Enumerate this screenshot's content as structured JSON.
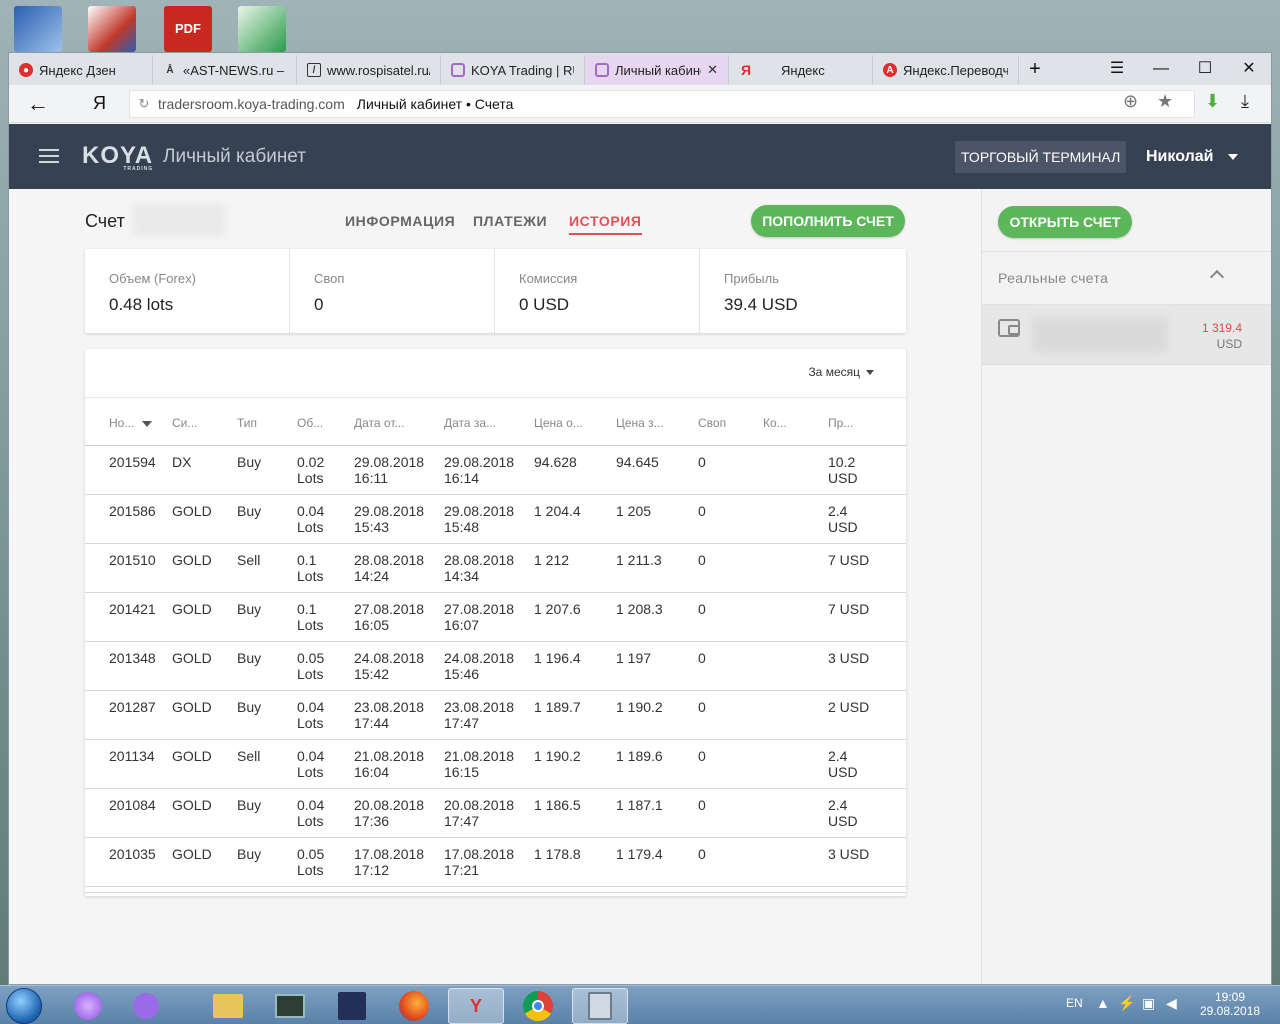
{
  "desktop": {
    "icons": [
      "word-doc-icon",
      "app-icon",
      "pdf-icon",
      "shortcut-icon"
    ],
    "pdf_label": "PDF"
  },
  "browser": {
    "tabs": [
      {
        "label": "Яндекс Дзен",
        "icon": "zen-icon",
        "color": "#e02d2d"
      },
      {
        "label": "«AST-NEWS.ru – А",
        "icon": "ast-icon",
        "color": "#333333"
      },
      {
        "label": "www.rospisatel.ru/",
        "icon": "site-icon",
        "color": "#333333"
      },
      {
        "label": "KOYA Trading | RU",
        "icon": "koya-icon",
        "color": "#a36bc2"
      },
      {
        "label": "Личный кабине",
        "icon": "koya-icon",
        "color": "#a36bc2"
      },
      {
        "label": "Яндекс",
        "icon": "yandex-icon",
        "color": "#e02d2d"
      },
      {
        "label": "Яндекс.Переводч",
        "icon": "translate-icon",
        "color": "#e02d2d"
      }
    ],
    "new_tab": "+",
    "address": {
      "back": "←",
      "ya": "Я",
      "domain": "tradersroom.koya-trading.com",
      "title": "Личный кабинет • Счета"
    }
  },
  "header": {
    "logo": "KOYA",
    "logo_sub": "TRADING",
    "title": "Личный кабинет",
    "terminal_button": "ТОРГОВЫЙ ТЕРМИНАЛ",
    "user": "Николай"
  },
  "account": {
    "label": "Счет",
    "tabs": [
      "ИНФОРМАЦИЯ",
      "ПЛАТЕЖИ",
      "ИСТОРИЯ"
    ],
    "active_tab": "ИСТОРИЯ",
    "deposit_button": "ПОПОЛНИТЬ СЧЕТ"
  },
  "stats": [
    {
      "label": "Объем (Forex)",
      "value": "0.48 lots"
    },
    {
      "label": "Своп",
      "value": "0"
    },
    {
      "label": "Комиссия",
      "value": "0 USD"
    },
    {
      "label": "Прибыль",
      "value": "39.4 USD"
    }
  ],
  "table": {
    "period": "За месяц",
    "columns": [
      "Но...",
      "Си...",
      "Тип",
      "Об...",
      "Дата от...",
      "Дата за...",
      "Цена о...",
      "Цена з...",
      "Своп",
      "Ко...",
      "Пр..."
    ],
    "rows": [
      {
        "num": "201594",
        "sym": "DX",
        "type": "Buy",
        "vol1": "0.02",
        "vol2": "Lots",
        "open_d": "29.08.2018",
        "open_t": "16:11",
        "close_d": "29.08.2018",
        "close_t": "16:14",
        "open_p": "94.628",
        "close_p": "94.645",
        "swap": "0",
        "comm": "",
        "profit1": "10.2",
        "profit2": "USD"
      },
      {
        "num": "201586",
        "sym": "GOLD",
        "type": "Buy",
        "vol1": "0.04",
        "vol2": "Lots",
        "open_d": "29.08.2018",
        "open_t": "15:43",
        "close_d": "29.08.2018",
        "close_t": "15:48",
        "open_p": "1 204.4",
        "close_p": "1 205",
        "swap": "0",
        "comm": "",
        "profit1": "2.4",
        "profit2": "USD"
      },
      {
        "num": "201510",
        "sym": "GOLD",
        "type": "Sell",
        "vol1": "0.1",
        "vol2": "Lots",
        "open_d": "28.08.2018",
        "open_t": "14:24",
        "close_d": "28.08.2018",
        "close_t": "14:34",
        "open_p": "1 212",
        "close_p": "1 211.3",
        "swap": "0",
        "comm": "",
        "profit1": "7 USD",
        "profit2": ""
      },
      {
        "num": "201421",
        "sym": "GOLD",
        "type": "Buy",
        "vol1": "0.1",
        "vol2": "Lots",
        "open_d": "27.08.2018",
        "open_t": "16:05",
        "close_d": "27.08.2018",
        "close_t": "16:07",
        "open_p": "1 207.6",
        "close_p": "1 208.3",
        "swap": "0",
        "comm": "",
        "profit1": "7 USD",
        "profit2": ""
      },
      {
        "num": "201348",
        "sym": "GOLD",
        "type": "Buy",
        "vol1": "0.05",
        "vol2": "Lots",
        "open_d": "24.08.2018",
        "open_t": "15:42",
        "close_d": "24.08.2018",
        "close_t": "15:46",
        "open_p": "1 196.4",
        "close_p": "1 197",
        "swap": "0",
        "comm": "",
        "profit1": "3 USD",
        "profit2": ""
      },
      {
        "num": "201287",
        "sym": "GOLD",
        "type": "Buy",
        "vol1": "0.04",
        "vol2": "Lots",
        "open_d": "23.08.2018",
        "open_t": "17:44",
        "close_d": "23.08.2018",
        "close_t": "17:47",
        "open_p": "1 189.7",
        "close_p": "1 190.2",
        "swap": "0",
        "comm": "",
        "profit1": "2 USD",
        "profit2": ""
      },
      {
        "num": "201134",
        "sym": "GOLD",
        "type": "Sell",
        "vol1": "0.04",
        "vol2": "Lots",
        "open_d": "21.08.2018",
        "open_t": "16:04",
        "close_d": "21.08.2018",
        "close_t": "16:15",
        "open_p": "1 190.2",
        "close_p": "1 189.6",
        "swap": "0",
        "comm": "",
        "profit1": "2.4",
        "profit2": "USD"
      },
      {
        "num": "201084",
        "sym": "GOLD",
        "type": "Buy",
        "vol1": "0.04",
        "vol2": "Lots",
        "open_d": "20.08.2018",
        "open_t": "17:36",
        "close_d": "20.08.2018",
        "close_t": "17:47",
        "open_p": "1 186.5",
        "close_p": "1 187.1",
        "swap": "0",
        "comm": "",
        "profit1": "2.4",
        "profit2": "USD"
      },
      {
        "num": "201035",
        "sym": "GOLD",
        "type": "Buy",
        "vol1": "0.05",
        "vol2": "Lots",
        "open_d": "17.08.2018",
        "open_t": "17:12",
        "close_d": "17.08.2018",
        "close_t": "17:21",
        "open_p": "1 178.8",
        "close_p": "1 179.4",
        "swap": "0",
        "comm": "",
        "profit1": "3 USD",
        "profit2": ""
      }
    ]
  },
  "sidebar": {
    "open_button": "ОТКРЫТЬ СЧЕТ",
    "section_label": "Реальные счета",
    "balance": "1 319.4",
    "currency": "USD"
  },
  "taskbar": {
    "apps": [
      "alice-icon",
      "mic-icon",
      "explorer-icon",
      "terminal-icon",
      "floppy-icon",
      "firefox-icon",
      "yandex-browser-icon",
      "chrome-icon",
      "calculator-icon"
    ],
    "yandex_glyph": "Y",
    "lang": "EN",
    "time": "19:09",
    "date": "29.08.2018"
  },
  "colors": {
    "accent_red": "#e0525a",
    "green": "#5bb75a",
    "header_bg": "#364152",
    "balance_red": "#e04848"
  }
}
